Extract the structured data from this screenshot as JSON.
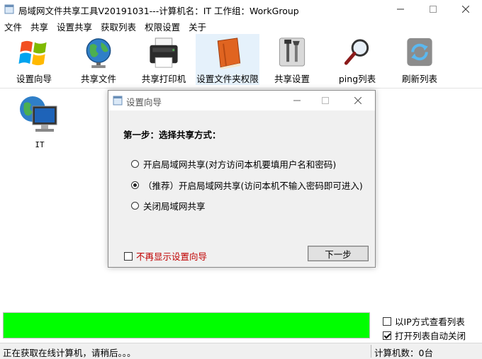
{
  "window": {
    "title": "局域网文件共享工具V20191031---计算机名：IT  工作组：WorkGroup",
    "icon": "app-window-icon",
    "controls": [
      "minimize",
      "maximize",
      "close"
    ]
  },
  "menu": [
    "文件",
    "共享",
    "设置共享",
    "获取列表",
    "权限设置",
    "关于"
  ],
  "toolbar": [
    {
      "label": "设置向导",
      "icon": "windows-logo-icon"
    },
    {
      "label": "共享文件",
      "icon": "globe-icon"
    },
    {
      "label": "共享打印机",
      "icon": "printer-icon"
    },
    {
      "label": "设置文件夹权限",
      "icon": "book-icon",
      "active": true
    },
    {
      "label": "共享设置",
      "icon": "tools-icon"
    },
    {
      "label": "ping列表",
      "icon": "magnifier-icon"
    },
    {
      "label": "刷新列表",
      "icon": "refresh-icon"
    }
  ],
  "computers": [
    {
      "name": "IT",
      "icon": "network-computer-icon"
    }
  ],
  "dialog": {
    "title": "设置向导",
    "step": "第一步：选择共享方式：",
    "options": [
      {
        "label": "开启局域网共享(对方访问本机要填用户名和密码)",
        "checked": false
      },
      {
        "label": "（推荐）开启局域网共享(访问本机不输入密码即可进入)",
        "checked": true
      },
      {
        "label": "关闭局域网共享",
        "checked": false
      }
    ],
    "no_show": {
      "label": "不再显示设置向导",
      "checked": false
    },
    "next_button": "下一步"
  },
  "progress": {
    "value_percent": 100,
    "color": "#00ff00"
  },
  "bottom_options": [
    {
      "label": "以IP方式查看列表",
      "checked": false
    },
    {
      "label": "打开列表自动关闭",
      "checked": true
    }
  ],
  "status": {
    "left": "正在获取在线计算机，请稍后。。。",
    "right": "计算机数：0台"
  },
  "colors": {
    "accent_active": "#e5f1fb",
    "progress": "#00ff00",
    "warning_text": "#c00000"
  }
}
